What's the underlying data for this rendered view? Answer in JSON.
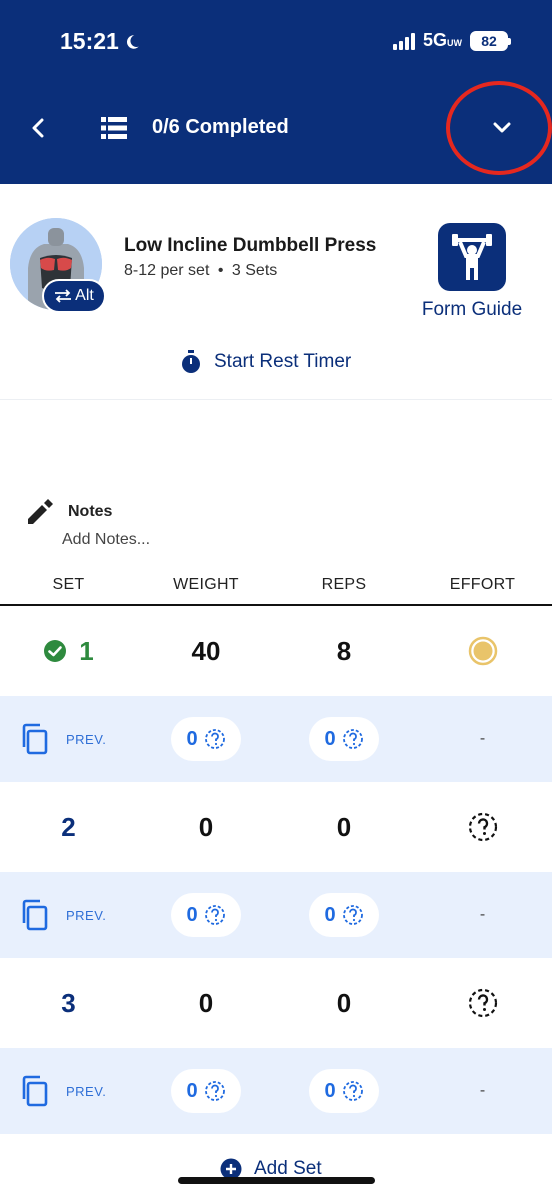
{
  "status_bar": {
    "time": "15:21",
    "network": "5G",
    "network_suffix": "UW",
    "battery": "82"
  },
  "header": {
    "completed_label": "0/6 Completed"
  },
  "exercise": {
    "name": "Low Incline Dumbbell Press",
    "reps_info": "8-12 per set",
    "separator": "•",
    "sets_info": "3 Sets",
    "alt_label": "Alt",
    "form_guide_label": "Form Guide",
    "rest_timer_label": "Start Rest Timer"
  },
  "notes": {
    "title": "Notes",
    "placeholder": "Add Notes..."
  },
  "table": {
    "headers": [
      "SET",
      "WEIGHT",
      "REPS",
      "EFFORT"
    ],
    "sets": [
      {
        "number": "1",
        "weight": "40",
        "reps": "8",
        "completed": true
      },
      {
        "number": "2",
        "weight": "0",
        "reps": "0",
        "completed": false
      },
      {
        "number": "3",
        "weight": "0",
        "reps": "0",
        "completed": false
      }
    ],
    "prev": {
      "label": "PREV.",
      "weight": "0",
      "reps": "0",
      "effort": "-"
    }
  },
  "add_set_label": "Add Set",
  "colors": {
    "header_bg": "#0b2f7a",
    "accent_blue": "#1f6ae0",
    "completed_green": "#2e8a3e",
    "prev_row_bg": "#e8f0fd",
    "effort_done": "#e9c46a",
    "highlight_circle": "#e5281f"
  }
}
